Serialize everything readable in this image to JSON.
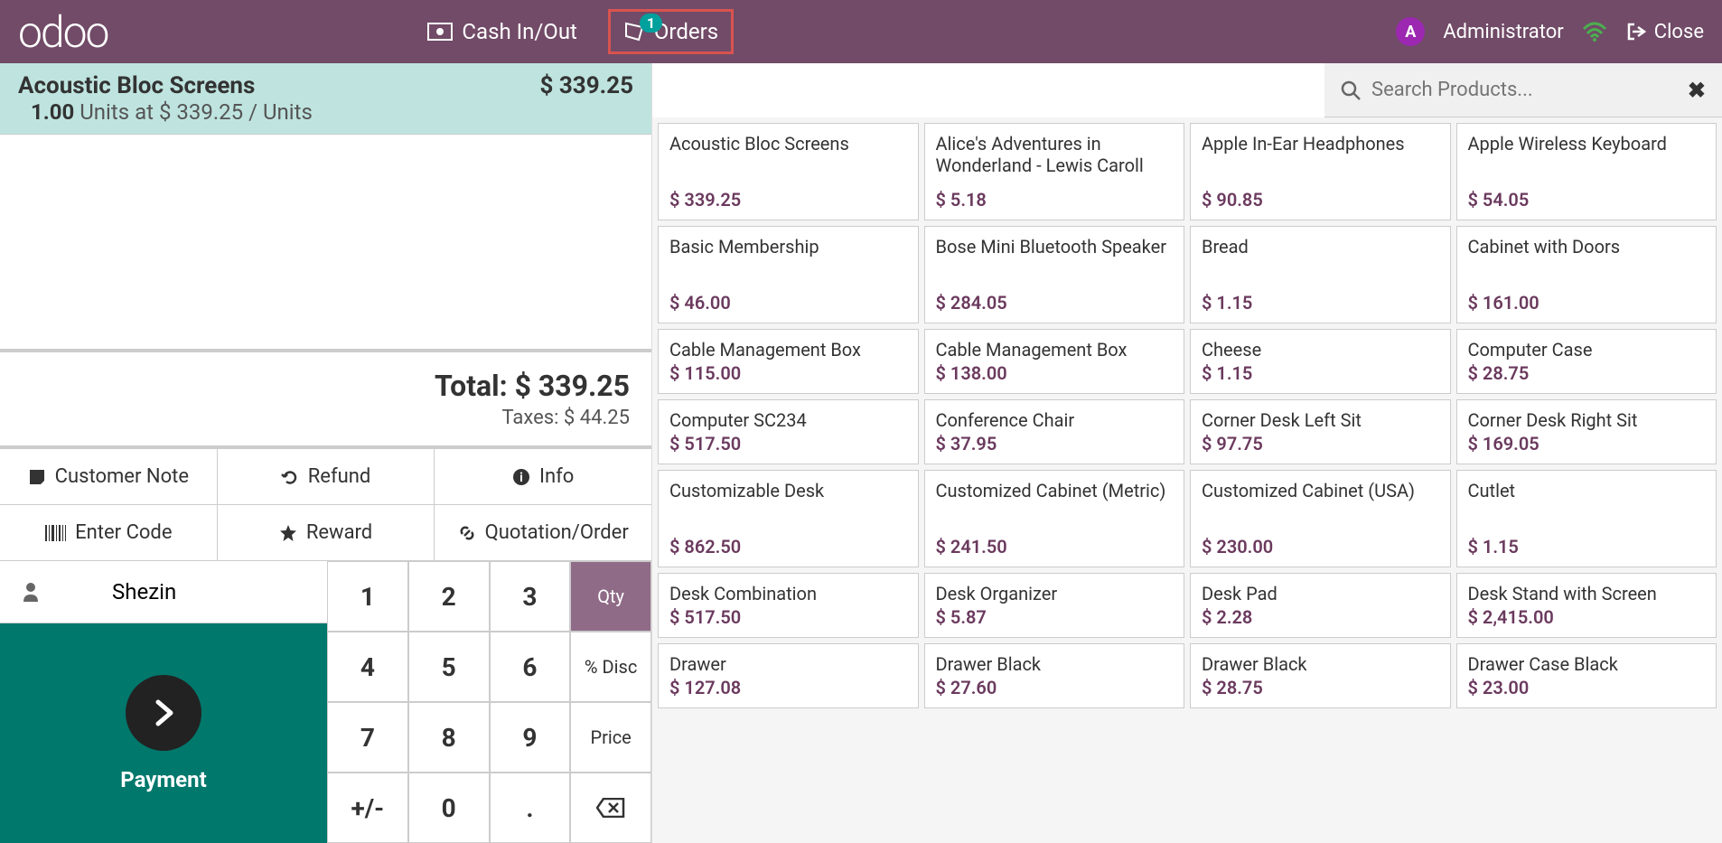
{
  "header": {
    "logo": "odoo",
    "cash_label": "Cash In/Out",
    "orders_label": "Orders",
    "orders_badge": "1",
    "user_initial": "A",
    "user_name": "Administrator",
    "close_label": "Close"
  },
  "order": {
    "product": "Acoustic Bloc Screens",
    "price": "$ 339.25",
    "qty": "1.00",
    "unit_text": "Units at $ 339.25 / Units",
    "total_label": "Total: ",
    "total_value": "$ 339.25",
    "taxes_label": "Taxes: ",
    "taxes_value": "$ 44.25"
  },
  "actions": {
    "note": "Customer Note",
    "refund": "Refund",
    "info": "Info",
    "code": "Enter Code",
    "reward": "Reward",
    "quotation": "Quotation/Order"
  },
  "customer": {
    "name": "Shezin",
    "payment_label": "Payment"
  },
  "numpad": {
    "k1": "1",
    "k2": "2",
    "k3": "3",
    "qty": "Qty",
    "k4": "4",
    "k5": "5",
    "k6": "6",
    "disc": "% Disc",
    "k7": "7",
    "k8": "8",
    "k9": "9",
    "price": "Price",
    "pm": "+/-",
    "k0": "0",
    "dot": ".",
    "bs": "⌫"
  },
  "search": {
    "placeholder": "Search Products..."
  },
  "products": [
    {
      "name": "Acoustic Bloc Screens",
      "price": "$ 339.25",
      "tall": true
    },
    {
      "name": "Alice's Adventures in Wonderland - Lewis Caroll",
      "price": "$ 5.18",
      "tall": true
    },
    {
      "name": "Apple In-Ear Headphones",
      "price": "$ 90.85",
      "tall": true
    },
    {
      "name": "Apple Wireless Keyboard",
      "price": "$ 54.05",
      "tall": true
    },
    {
      "name": "Basic Membership",
      "price": "$ 46.00",
      "tall": true
    },
    {
      "name": "Bose Mini Bluetooth Speaker",
      "price": "$ 284.05",
      "tall": true
    },
    {
      "name": "Bread",
      "price": "$ 1.15",
      "tall": true
    },
    {
      "name": "Cabinet with Doors",
      "price": "$ 161.00",
      "tall": true
    },
    {
      "name": "Cable Management Box",
      "price": "$ 115.00",
      "tall": false
    },
    {
      "name": "Cable Management Box",
      "price": "$ 138.00",
      "tall": false
    },
    {
      "name": "Cheese",
      "price": "$ 1.15",
      "tall": false
    },
    {
      "name": "Computer Case",
      "price": "$ 28.75",
      "tall": false
    },
    {
      "name": "Computer SC234",
      "price": "$ 517.50",
      "tall": false
    },
    {
      "name": "Conference Chair",
      "price": "$ 37.95",
      "tall": false
    },
    {
      "name": "Corner Desk Left Sit",
      "price": "$ 97.75",
      "tall": false
    },
    {
      "name": "Corner Desk Right Sit",
      "price": "$ 169.05",
      "tall": false
    },
    {
      "name": "Customizable Desk",
      "price": "$ 862.50",
      "tall": true
    },
    {
      "name": "Customized Cabinet (Metric)",
      "price": "$ 241.50",
      "tall": true
    },
    {
      "name": "Customized Cabinet (USA)",
      "price": "$ 230.00",
      "tall": true
    },
    {
      "name": "Cutlet",
      "price": "$ 1.15",
      "tall": true
    },
    {
      "name": "Desk Combination",
      "price": "$ 517.50",
      "tall": false
    },
    {
      "name": "Desk Organizer",
      "price": "$ 5.87",
      "tall": false
    },
    {
      "name": "Desk Pad",
      "price": "$ 2.28",
      "tall": false
    },
    {
      "name": "Desk Stand with Screen",
      "price": "$ 2,415.00",
      "tall": false
    },
    {
      "name": "Drawer",
      "price": "$ 127.08",
      "tall": false
    },
    {
      "name": "Drawer Black",
      "price": "$ 27.60",
      "tall": false
    },
    {
      "name": "Drawer Black",
      "price": "$ 28.75",
      "tall": false
    },
    {
      "name": "Drawer Case Black",
      "price": "$ 23.00",
      "tall": false
    }
  ]
}
